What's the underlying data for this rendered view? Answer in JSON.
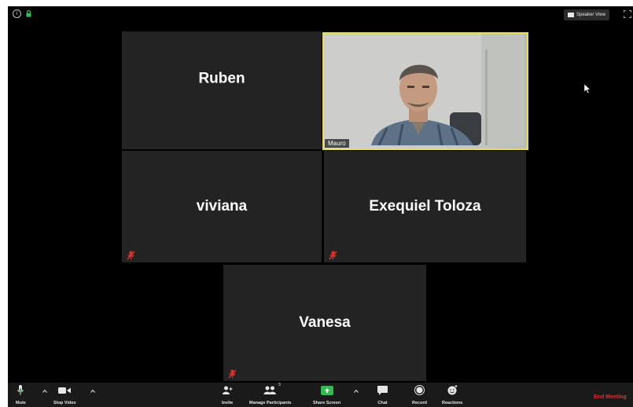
{
  "top_bar": {
    "info_symbol": "i",
    "speaker_view_label": "Speaker View"
  },
  "participants": {
    "ruben": "Ruben",
    "viviana": "viviana",
    "exequiel": "Exequiel Toloza",
    "vanesa": "Vanesa",
    "mauro": "Mauro"
  },
  "toolbar": {
    "mute": "Mute",
    "stop_video": "Stop Video",
    "invite": "Invite",
    "manage_participants": "Manage Participants",
    "participant_count": "5",
    "share_screen": "Share Screen",
    "chat": "Chat",
    "record": "Record",
    "reactions": "Reactions",
    "end_meeting": "End Meeting"
  },
  "colors": {
    "active_speaker_border": "#e5e04a",
    "mute_red": "#d9342b",
    "share_green": "#2dbd4d",
    "end_red": "#e0302e",
    "lock_green": "#34c15a"
  }
}
